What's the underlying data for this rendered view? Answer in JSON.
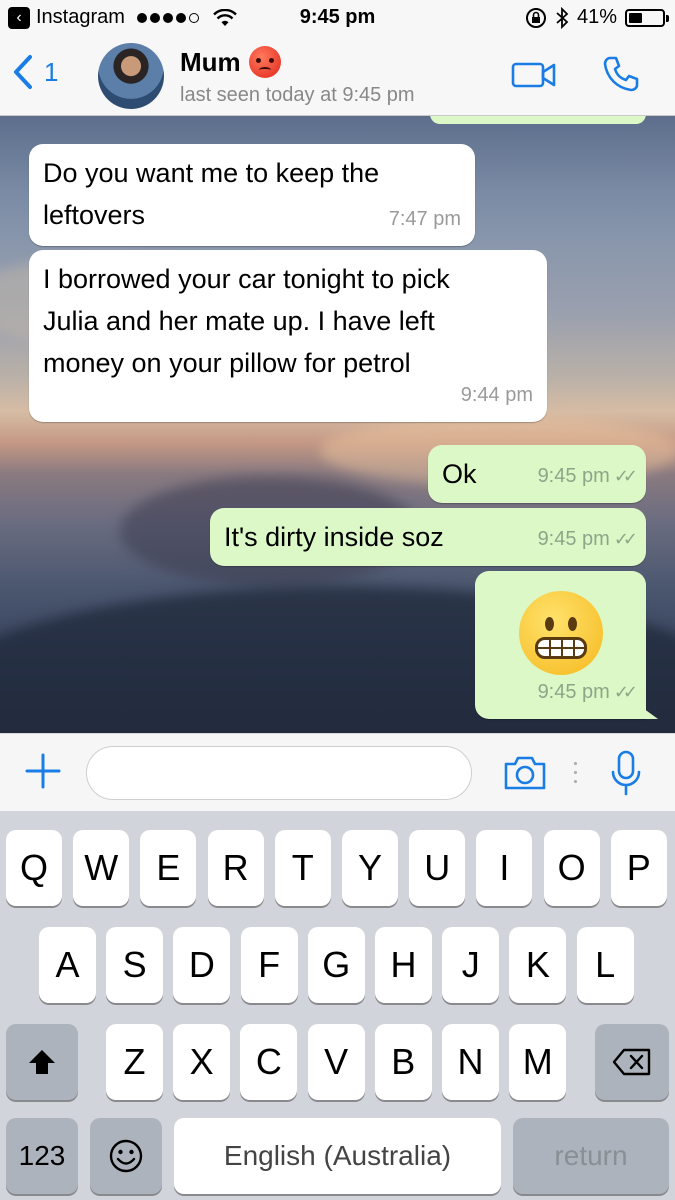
{
  "status_bar": {
    "back_app_label": "Instagram",
    "time": "9:45 pm",
    "battery_text": "41%",
    "battery_level": 0.41
  },
  "header": {
    "back_count": "1",
    "contact_name": "Mum",
    "last_seen": "last seen today at 9:45 pm"
  },
  "messages": [
    {
      "direction": "in",
      "text": "Do you want me to keep the\nleftovers",
      "time": "7:47 pm"
    },
    {
      "direction": "in",
      "text": "I borrowed your car tonight to pick\nJulia and her mate up. I have left\nmoney on your pillow for petrol",
      "time": "9:44 pm"
    },
    {
      "direction": "out",
      "text": "Ok",
      "time": "9:45 pm"
    },
    {
      "direction": "out",
      "text": "It's dirty inside soz",
      "time": "9:45 pm"
    },
    {
      "direction": "out",
      "emoji": "grimacing-face",
      "time": "9:45 pm"
    }
  ],
  "input": {
    "placeholder": "",
    "value": ""
  },
  "keyboard": {
    "row1": [
      "Q",
      "W",
      "E",
      "R",
      "T",
      "Y",
      "U",
      "I",
      "O",
      "P"
    ],
    "row2": [
      "A",
      "S",
      "D",
      "F",
      "G",
      "H",
      "J",
      "K",
      "L"
    ],
    "row3": [
      "Z",
      "X",
      "C",
      "V",
      "B",
      "N",
      "M"
    ],
    "numbers_label": "123",
    "space_label": "English (Australia)",
    "return_label": "return"
  },
  "colors": {
    "accent": "#1a7de6",
    "outgoing_bubble": "#dcf8c6",
    "incoming_bubble": "#ffffff",
    "keyboard_bg": "#d1d5db"
  }
}
